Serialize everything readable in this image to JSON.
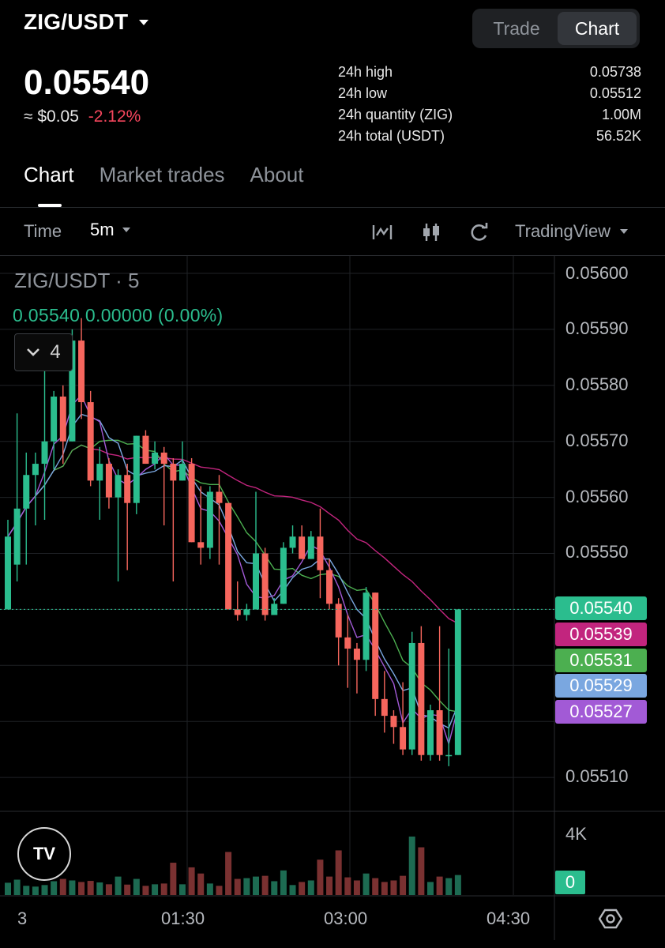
{
  "header": {
    "pair": "ZIG/USDT",
    "toggle": {
      "trade": "Trade",
      "chart": "Chart"
    },
    "last_price": "0.05540",
    "approx_usd": "≈ $0.05",
    "change_pct": "-2.12%",
    "stats": [
      {
        "label": "24h high",
        "value": "0.05738"
      },
      {
        "label": "24h low",
        "value": "0.05512"
      },
      {
        "label": "24h quantity (ZIG)",
        "value": "1.00M"
      },
      {
        "label": "24h total (USDT)",
        "value": "56.52K"
      }
    ]
  },
  "tabs": [
    {
      "label": "Chart"
    },
    {
      "label": "Market trades"
    },
    {
      "label": "About"
    }
  ],
  "toolbar": {
    "time_label": "Time",
    "interval": "5m",
    "provider": "TradingView",
    "icons": [
      "indicator-icon",
      "candles-icon",
      "refresh-icon"
    ]
  },
  "legend": {
    "title": "ZIG/USDT · 5",
    "values": "0.05540  0.00000  (0.00%)",
    "indicator_count": "4"
  },
  "price_axis": {
    "labels": [
      "0.05600",
      "0.05590",
      "0.05580",
      "0.05570",
      "0.05560",
      "0.05550",
      "0.05510"
    ]
  },
  "price_tags": [
    {
      "value": "0.05540",
      "color": "#2bbd8e"
    },
    {
      "value": "0.05539",
      "color": "#c2257e"
    },
    {
      "value": "0.05531",
      "color": "#4caf50"
    },
    {
      "value": "0.05529",
      "color": "#7aa7e0"
    },
    {
      "value": "0.05527",
      "color": "#a25ad6"
    }
  ],
  "volume_axis": {
    "top_label": "4K",
    "zero_label": "0"
  },
  "time_axis": {
    "labels": [
      "3",
      "01:30",
      "03:00",
      "04:30"
    ]
  },
  "tv_logo_text": "TV",
  "colors": {
    "up": "#2bbd8e",
    "down": "#f6665d",
    "grid": "#1f2226"
  },
  "chart_data": {
    "type": "candlestick",
    "price_min": 0.055,
    "price_max": 0.05603,
    "candles": [
      {
        "o": 0.0554,
        "h": 0.05556,
        "l": 0.0554,
        "c": 0.05553
      },
      {
        "o": 0.05548,
        "h": 0.05575,
        "l": 0.05545,
        "c": 0.05558
      },
      {
        "o": 0.05558,
        "h": 0.05568,
        "l": 0.05548,
        "c": 0.05564
      },
      {
        "o": 0.05564,
        "h": 0.05568,
        "l": 0.05555,
        "c": 0.05566
      },
      {
        "o": 0.05566,
        "h": 0.05584,
        "l": 0.05556,
        "c": 0.0557
      },
      {
        "o": 0.0557,
        "h": 0.05579,
        "l": 0.05565,
        "c": 0.05578
      },
      {
        "o": 0.05578,
        "h": 0.0558,
        "l": 0.05566,
        "c": 0.0557
      },
      {
        "o": 0.0557,
        "h": 0.0559,
        "l": 0.0557,
        "c": 0.05588
      },
      {
        "o": 0.05588,
        "h": 0.05592,
        "l": 0.05574,
        "c": 0.05577
      },
      {
        "o": 0.05577,
        "h": 0.05579,
        "l": 0.05562,
        "c": 0.05563
      },
      {
        "o": 0.05563,
        "h": 0.05569,
        "l": 0.05556,
        "c": 0.05566
      },
      {
        "o": 0.05566,
        "h": 0.05567,
        "l": 0.05558,
        "c": 0.0556
      },
      {
        "o": 0.0556,
        "h": 0.05565,
        "l": 0.05545,
        "c": 0.05564
      },
      {
        "o": 0.05564,
        "h": 0.05566,
        "l": 0.05547,
        "c": 0.05559
      },
      {
        "o": 0.05559,
        "h": 0.05571,
        "l": 0.05557,
        "c": 0.05571
      },
      {
        "o": 0.05571,
        "h": 0.05572,
        "l": 0.05566,
        "c": 0.05566
      },
      {
        "o": 0.05566,
        "h": 0.0557,
        "l": 0.05565,
        "c": 0.05568
      },
      {
        "o": 0.05568,
        "h": 0.05569,
        "l": 0.05555,
        "c": 0.05566
      },
      {
        "o": 0.05566,
        "h": 0.05567,
        "l": 0.05545,
        "c": 0.05563
      },
      {
        "o": 0.05563,
        "h": 0.0557,
        "l": 0.05563,
        "c": 0.05566
      },
      {
        "o": 0.05566,
        "h": 0.05567,
        "l": 0.05552,
        "c": 0.05552
      },
      {
        "o": 0.05552,
        "h": 0.05562,
        "l": 0.05548,
        "c": 0.05551
      },
      {
        "o": 0.05551,
        "h": 0.05562,
        "l": 0.05549,
        "c": 0.05561
      },
      {
        "o": 0.05561,
        "h": 0.05564,
        "l": 0.05548,
        "c": 0.05559
      },
      {
        "o": 0.05559,
        "h": 0.05559,
        "l": 0.0554,
        "c": 0.0554
      },
      {
        "o": 0.0554,
        "h": 0.05545,
        "l": 0.05538,
        "c": 0.05539
      },
      {
        "o": 0.05539,
        "h": 0.05541,
        "l": 0.05538,
        "c": 0.0554
      },
      {
        "o": 0.0554,
        "h": 0.05561,
        "l": 0.0554,
        "c": 0.0555
      },
      {
        "o": 0.0555,
        "h": 0.05551,
        "l": 0.05538,
        "c": 0.05539
      },
      {
        "o": 0.05539,
        "h": 0.05542,
        "l": 0.05539,
        "c": 0.05541
      },
      {
        "o": 0.05541,
        "h": 0.05552,
        "l": 0.05541,
        "c": 0.05551
      },
      {
        "o": 0.05551,
        "h": 0.05555,
        "l": 0.0555,
        "c": 0.05553
      },
      {
        "o": 0.05553,
        "h": 0.05555,
        "l": 0.05549,
        "c": 0.05549
      },
      {
        "o": 0.05549,
        "h": 0.05554,
        "l": 0.05549,
        "c": 0.05553
      },
      {
        "o": 0.05553,
        "h": 0.05558,
        "l": 0.05542,
        "c": 0.05547
      },
      {
        "o": 0.05547,
        "h": 0.05549,
        "l": 0.0554,
        "c": 0.05541
      },
      {
        "o": 0.05541,
        "h": 0.05542,
        "l": 0.0553,
        "c": 0.05535
      },
      {
        "o": 0.05535,
        "h": 0.05539,
        "l": 0.05526,
        "c": 0.05533
      },
      {
        "o": 0.05533,
        "h": 0.05534,
        "l": 0.05525,
        "c": 0.05531
      },
      {
        "o": 0.05531,
        "h": 0.05544,
        "l": 0.05529,
        "c": 0.05543
      },
      {
        "o": 0.05543,
        "h": 0.05543,
        "l": 0.05521,
        "c": 0.05524
      },
      {
        "o": 0.05524,
        "h": 0.05529,
        "l": 0.05518,
        "c": 0.05521
      },
      {
        "o": 0.05521,
        "h": 0.05522,
        "l": 0.05516,
        "c": 0.05519
      },
      {
        "o": 0.05519,
        "h": 0.05527,
        "l": 0.05514,
        "c": 0.05515
      },
      {
        "o": 0.05515,
        "h": 0.05536,
        "l": 0.05514,
        "c": 0.05534
      },
      {
        "o": 0.05534,
        "h": 0.05537,
        "l": 0.05513,
        "c": 0.05514
      },
      {
        "o": 0.05514,
        "h": 0.05523,
        "l": 0.05513,
        "c": 0.05522
      },
      {
        "o": 0.05522,
        "h": 0.05537,
        "l": 0.05513,
        "c": 0.05514
      },
      {
        "o": 0.05514,
        "h": 0.05533,
        "l": 0.05512,
        "c": 0.05514
      },
      {
        "o": 0.05514,
        "h": 0.0554,
        "l": 0.05514,
        "c": 0.0554
      }
    ],
    "volumes": [
      800,
      1000,
      600,
      550,
      650,
      900,
      1050,
      950,
      850,
      920,
      820,
      700,
      1200,
      680,
      1050,
      600,
      700,
      750,
      2100,
      700,
      1800,
      1400,
      750,
      600,
      2800,
      1050,
      1100,
      1200,
      1250,
      900,
      1600,
      650,
      850,
      950,
      2300,
      1200,
      2900,
      1150,
      950,
      1400,
      1100,
      850,
      950,
      1250,
      3800,
      3100,
      850,
      1200,
      1100,
      1300
    ]
  }
}
